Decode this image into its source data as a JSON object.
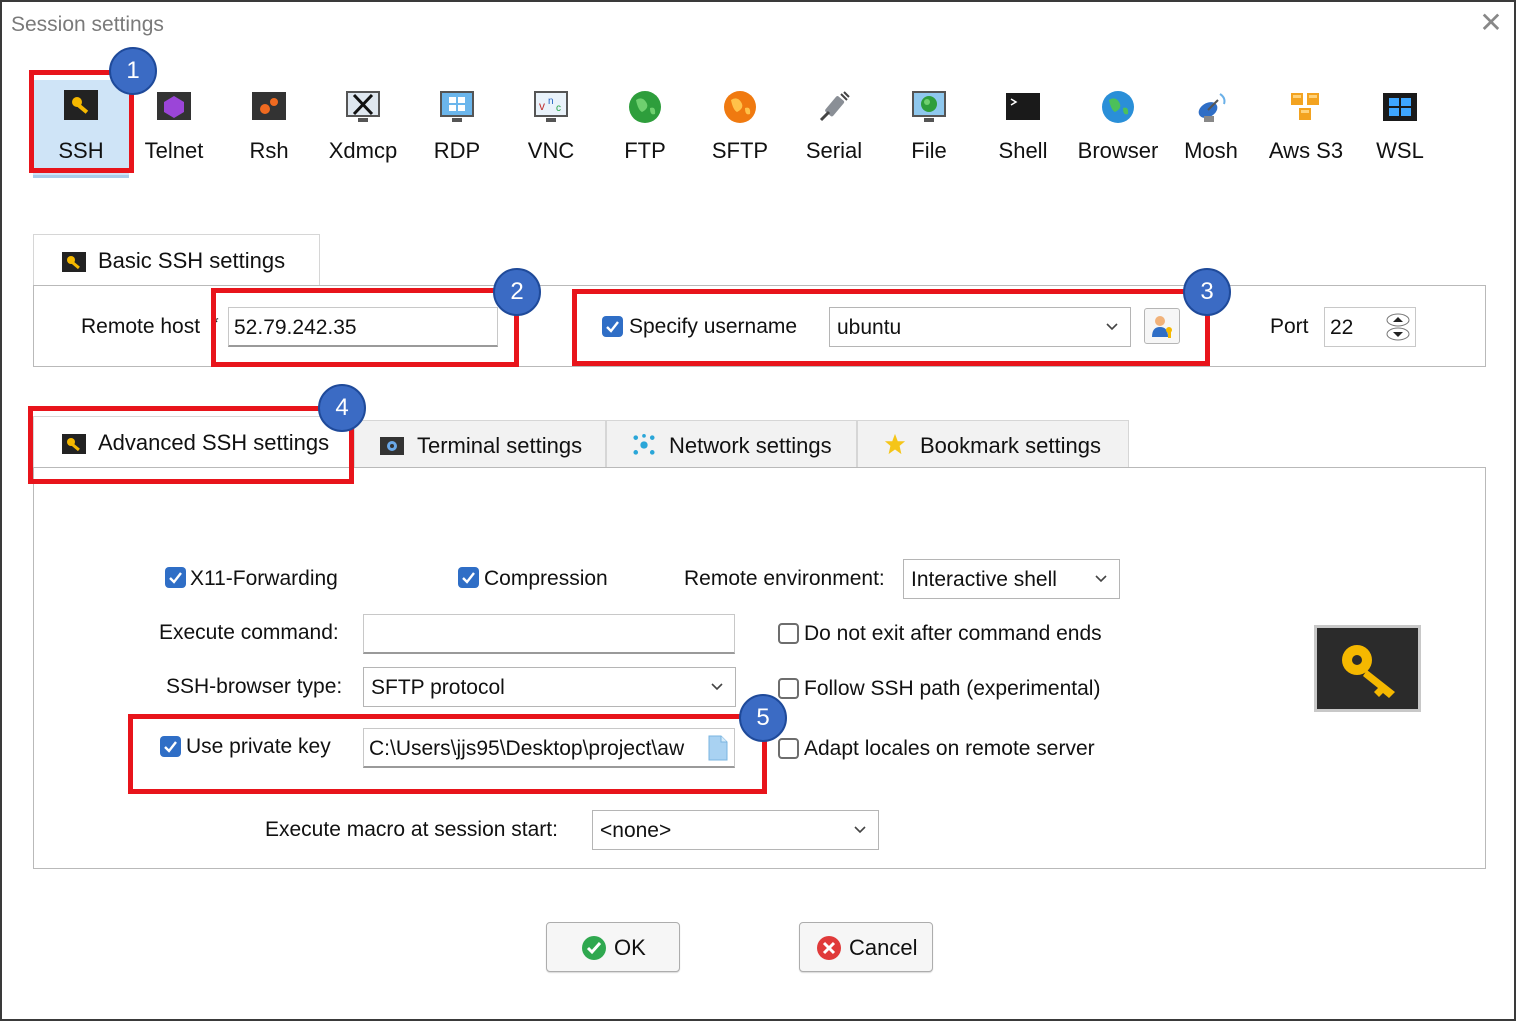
{
  "window": {
    "title": "Session settings",
    "close_glyph": "✕"
  },
  "session_types": [
    {
      "label": "SSH",
      "icon": "ssh-key-icon",
      "selected": true
    },
    {
      "label": "Telnet",
      "icon": "telnet-icon"
    },
    {
      "label": "Rsh",
      "icon": "rsh-icon"
    },
    {
      "label": "Xdmcp",
      "icon": "xdmcp-icon"
    },
    {
      "label": "RDP",
      "icon": "rdp-icon"
    },
    {
      "label": "VNC",
      "icon": "vnc-icon"
    },
    {
      "label": "FTP",
      "icon": "ftp-globe-icon"
    },
    {
      "label": "SFTP",
      "icon": "sftp-globe-icon"
    },
    {
      "label": "Serial",
      "icon": "serial-plug-icon"
    },
    {
      "label": "File",
      "icon": "file-monitor-icon"
    },
    {
      "label": "Shell",
      "icon": "shell-terminal-icon"
    },
    {
      "label": "Browser",
      "icon": "browser-globe-icon"
    },
    {
      "label": "Mosh",
      "icon": "mosh-satellite-icon"
    },
    {
      "label": "Aws S3",
      "icon": "aws-s3-cubes-icon"
    },
    {
      "label": "WSL",
      "icon": "wsl-windows-icon"
    }
  ],
  "badges": [
    "1",
    "2",
    "3",
    "4",
    "5"
  ],
  "basic": {
    "tab_label": "Basic SSH settings",
    "remote_host_label": "Remote host",
    "required_mark": "*",
    "remote_host_value": "52.79.242.35",
    "specify_username_label": "Specify username",
    "specify_username_checked": true,
    "username_value": "ubuntu",
    "port_label": "Port",
    "port_value": "22"
  },
  "tabs": [
    {
      "label": "Advanced SSH settings",
      "icon": "wrench-key-icon",
      "active": true
    },
    {
      "label": "Terminal settings",
      "icon": "terminal-gear-icon"
    },
    {
      "label": "Network settings",
      "icon": "network-nodes-icon"
    },
    {
      "label": "Bookmark settings",
      "icon": "star-icon"
    }
  ],
  "advanced": {
    "x11_label": "X11-Forwarding",
    "x11_checked": true,
    "compression_label": "Compression",
    "compression_checked": true,
    "remote_env_label": "Remote environment:",
    "remote_env_value": "Interactive shell",
    "execute_command_label": "Execute command:",
    "execute_command_value": "",
    "do_not_exit_label": "Do not exit after command ends",
    "do_not_exit_checked": false,
    "browser_type_label": "SSH-browser type:",
    "browser_type_value": "SFTP protocol",
    "follow_path_label": "Follow SSH path (experimental)",
    "follow_path_checked": false,
    "private_key_label": "Use private key",
    "private_key_checked": true,
    "private_key_value": "C:\\Users\\jjs95\\Desktop\\project\\aw",
    "adapt_locales_label": "Adapt locales on remote server",
    "adapt_locales_checked": false,
    "macro_label": "Execute macro at session start:",
    "macro_value": "<none>"
  },
  "buttons": {
    "ok_label": "OK",
    "cancel_label": "Cancel"
  },
  "colors": {
    "highlight_red": "#e8141b",
    "badge_blue": "#3b6bc4",
    "selected_bg": "#cfe4f7",
    "checkbox_blue": "#2f6ec6"
  }
}
